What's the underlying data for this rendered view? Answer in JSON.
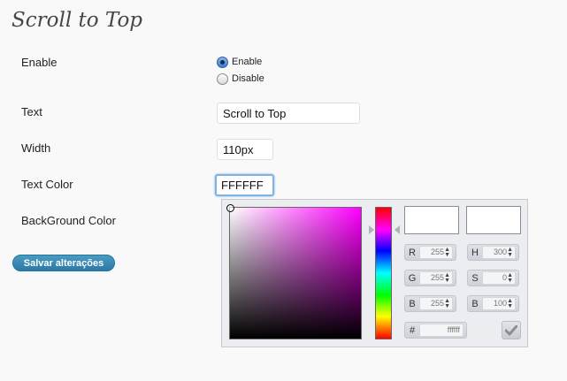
{
  "page": {
    "title": "Scroll to Top"
  },
  "form": {
    "enable": {
      "label": "Enable",
      "options": [
        "Enable",
        "Disable"
      ],
      "selected": "Enable"
    },
    "text": {
      "label": "Text",
      "value": "Scroll to Top"
    },
    "width": {
      "label": "Width",
      "value": "110px"
    },
    "text_color": {
      "label": "Text Color",
      "value": "FFFFFF"
    },
    "background_color": {
      "label": "BackGround Color"
    },
    "save_label": "Salvar alterações"
  },
  "color_picker": {
    "current_color": "#ffffff",
    "hue_color": "#ff00ff",
    "fields": {
      "r": {
        "label": "R",
        "value": "255"
      },
      "g": {
        "label": "G",
        "value": "255"
      },
      "b": {
        "label": "B",
        "value": "255"
      },
      "h": {
        "label": "H",
        "value": "300"
      },
      "s": {
        "label": "S",
        "value": "0"
      },
      "v": {
        "label": "B",
        "value": "100"
      }
    },
    "hex": {
      "label": "#",
      "value": "ffffff"
    },
    "submit_icon": "checkmark-icon"
  }
}
